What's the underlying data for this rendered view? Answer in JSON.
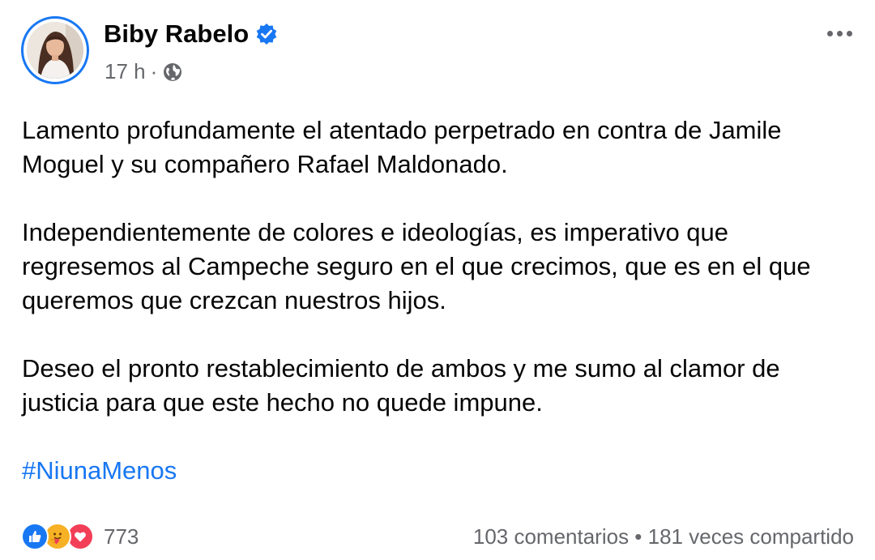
{
  "post": {
    "author": "Biby Rabelo",
    "time": "17 h",
    "separator": "·",
    "paragraphs": [
      "Lamento profundamente el atentado perpetrado en contra de Jamile Moguel y su compañero Rafael Maldonado.",
      "Independientemente de colores e ideologías, es imperativo que regresemos al Campeche seguro en el que crecimos, que es en el que queremos que crezcan nuestros hijos.",
      "Deseo el pronto restablecimiento de ambos y me sumo al clamor de justicia para que este hecho no quede impune."
    ],
    "hashtag": "#NiunaMenos"
  },
  "footer": {
    "reaction_icons": [
      "like-icon",
      "care-icon",
      "love-icon"
    ],
    "reaction_count": "773",
    "stats": "103 comentarios • 181 veces compartido"
  },
  "colors": {
    "accent": "#1877f2",
    "secondary_text": "#65676b",
    "love": "#f33e58",
    "care": "#f7b125"
  }
}
